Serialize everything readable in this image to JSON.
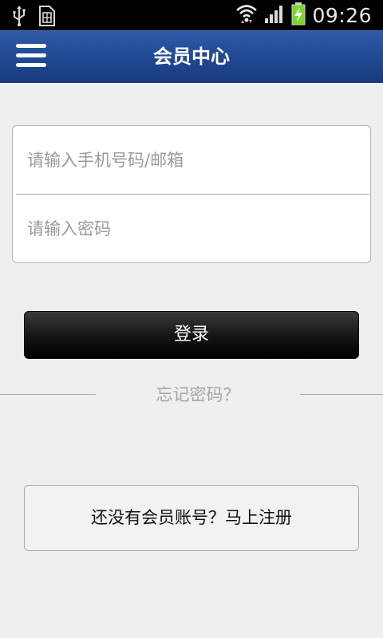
{
  "status_bar": {
    "time": "09:26",
    "icons": [
      "usb-icon",
      "sim-icon",
      "wifi-icon",
      "signal-icon",
      "battery-charging-icon"
    ],
    "battery_color": "#7cd52a"
  },
  "app_bar": {
    "title": "会员中心",
    "menu_icon": "hamburger-menu-icon",
    "background": "#1f468f"
  },
  "login_form": {
    "phone_placeholder": "请输入手机号码/邮箱",
    "phone_value": "",
    "password_placeholder": "请输入密码",
    "password_value": ""
  },
  "login_button": {
    "label": "登录"
  },
  "forgot_password": {
    "label": "忘记密码？"
  },
  "register_button": {
    "label": "还没有会员账号？马上注册"
  }
}
